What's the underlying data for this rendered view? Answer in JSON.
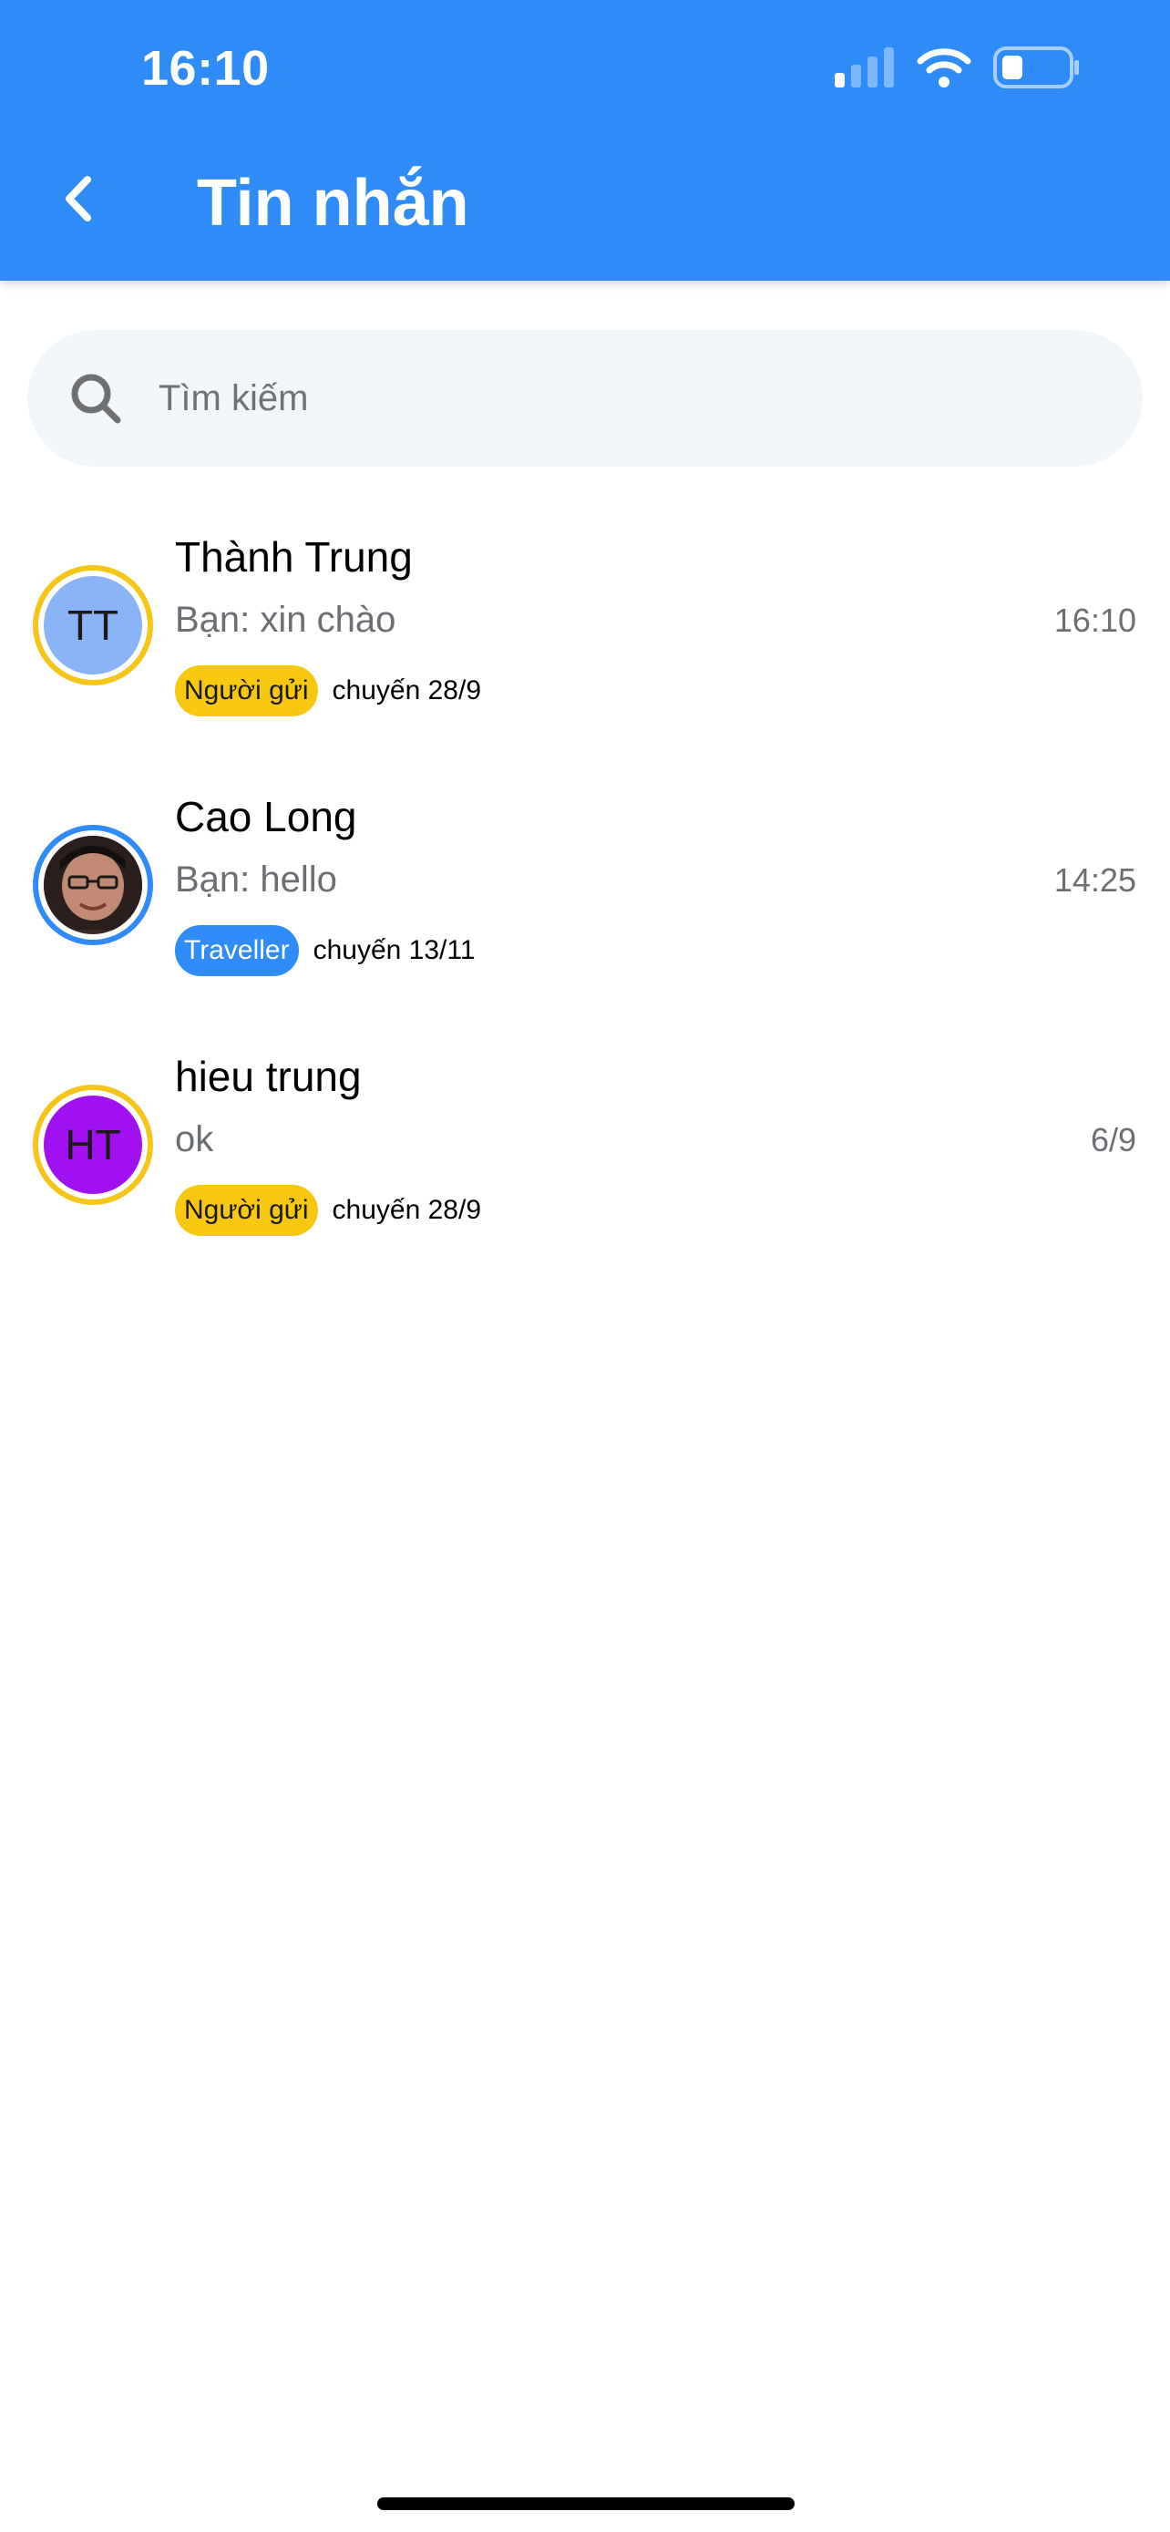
{
  "status_bar": {
    "time": "16:10"
  },
  "header": {
    "title": "Tin nhắn",
    "back_icon": "chevron-left-icon"
  },
  "search": {
    "placeholder": "Tìm kiếm",
    "value": "",
    "icon": "search-icon"
  },
  "colors": {
    "primary": "#2e8bf7",
    "sender_badge": "#f8c811",
    "traveller_badge": "#2e8bf7",
    "ring_sender": "#f5c518",
    "ring_traveller": "#2e8bf7"
  },
  "conversations": [
    {
      "name": "Thành Trung",
      "preview": "Bạn: xin chào",
      "time": "16:10",
      "initials": "TT",
      "avatar_color": "#8ab4f8",
      "role": "Người gửi",
      "trip": "chuyến 28/9"
    },
    {
      "name": "Cao Long",
      "preview": "Bạn: hello",
      "time": "14:25",
      "initials": "",
      "avatar_color": "#3a2a25",
      "role": "Traveller",
      "trip": "chuyến 13/11"
    },
    {
      "name": "hieu trung",
      "preview": "ok",
      "time": "6/9",
      "initials": "HT",
      "avatar_color": "#a010f0",
      "role": "Người gửi",
      "trip": "chuyến 28/9"
    }
  ]
}
